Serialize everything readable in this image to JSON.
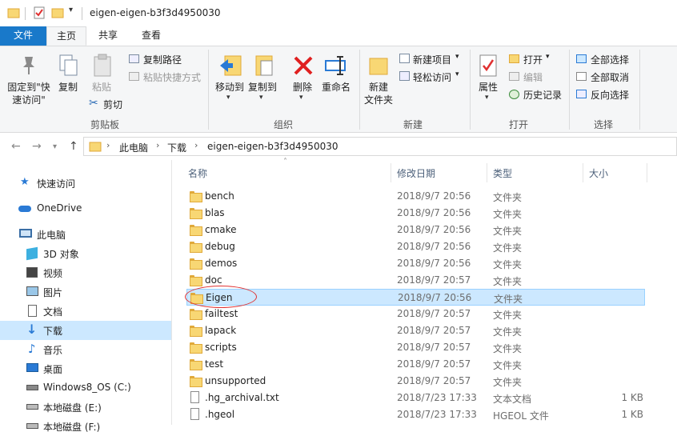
{
  "window": {
    "title": "eigen-eigen-b3f3d4950030"
  },
  "tabs": {
    "file": "文件",
    "home": "主页",
    "share": "共享",
    "view": "查看"
  },
  "ribbon": {
    "clipboard": {
      "pin": "固定到\"快速访问\"",
      "copy": "复制",
      "paste": "粘贴",
      "copy_path": "复制路径",
      "paste_shortcut": "粘贴快捷方式",
      "cut": "剪切",
      "label": "剪贴板"
    },
    "organize": {
      "move_to": "移动到",
      "copy_to": "复制到",
      "delete": "删除",
      "rename": "重命名",
      "label": "组织"
    },
    "new": {
      "new_folder": "新建\n文件夹",
      "new_item": "新建项目",
      "easy_access": "轻松访问",
      "label": "新建"
    },
    "open": {
      "properties": "属性",
      "open": "打开",
      "edit": "编辑",
      "history": "历史记录",
      "label": "打开"
    },
    "select": {
      "select_all": "全部选择",
      "select_none": "全部取消",
      "invert": "反向选择",
      "label": "选择"
    }
  },
  "address": {
    "crumbs": [
      "此电脑",
      "下载",
      "eigen-eigen-b3f3d4950030"
    ]
  },
  "nav": {
    "items": [
      {
        "label": "快速访问"
      },
      {
        "label": "OneDrive"
      },
      {
        "label": "此电脑"
      },
      {
        "label": "3D 对象"
      },
      {
        "label": "视频"
      },
      {
        "label": "图片"
      },
      {
        "label": "文档"
      },
      {
        "label": "下载"
      },
      {
        "label": "音乐"
      },
      {
        "label": "桌面"
      },
      {
        "label": "Windows8_OS (C:)"
      },
      {
        "label": "本地磁盘 (E:)"
      },
      {
        "label": "本地磁盘 (F:)"
      }
    ]
  },
  "list": {
    "headers": {
      "name": "名称",
      "date": "修改日期",
      "type": "类型",
      "size": "大小"
    },
    "rows": [
      {
        "name": "bench",
        "date": "2018/9/7 20:56",
        "type": "文件夹",
        "size": ""
      },
      {
        "name": "blas",
        "date": "2018/9/7 20:56",
        "type": "文件夹",
        "size": ""
      },
      {
        "name": "cmake",
        "date": "2018/9/7 20:56",
        "type": "文件夹",
        "size": ""
      },
      {
        "name": "debug",
        "date": "2018/9/7 20:56",
        "type": "文件夹",
        "size": ""
      },
      {
        "name": "demos",
        "date": "2018/9/7 20:56",
        "type": "文件夹",
        "size": ""
      },
      {
        "name": "doc",
        "date": "2018/9/7 20:57",
        "type": "文件夹",
        "size": ""
      },
      {
        "name": "Eigen",
        "date": "2018/9/7 20:56",
        "type": "文件夹",
        "size": ""
      },
      {
        "name": "failtest",
        "date": "2018/9/7 20:57",
        "type": "文件夹",
        "size": ""
      },
      {
        "name": "lapack",
        "date": "2018/9/7 20:57",
        "type": "文件夹",
        "size": ""
      },
      {
        "name": "scripts",
        "date": "2018/9/7 20:57",
        "type": "文件夹",
        "size": ""
      },
      {
        "name": "test",
        "date": "2018/9/7 20:57",
        "type": "文件夹",
        "size": ""
      },
      {
        "name": "unsupported",
        "date": "2018/9/7 20:57",
        "type": "文件夹",
        "size": ""
      },
      {
        "name": ".hg_archival.txt",
        "date": "2018/7/23 17:33",
        "type": "文本文档",
        "size": "1 KB"
      },
      {
        "name": ".hgeol",
        "date": "2018/7/23 17:33",
        "type": "HGEOL 文件",
        "size": "1 KB"
      }
    ]
  }
}
